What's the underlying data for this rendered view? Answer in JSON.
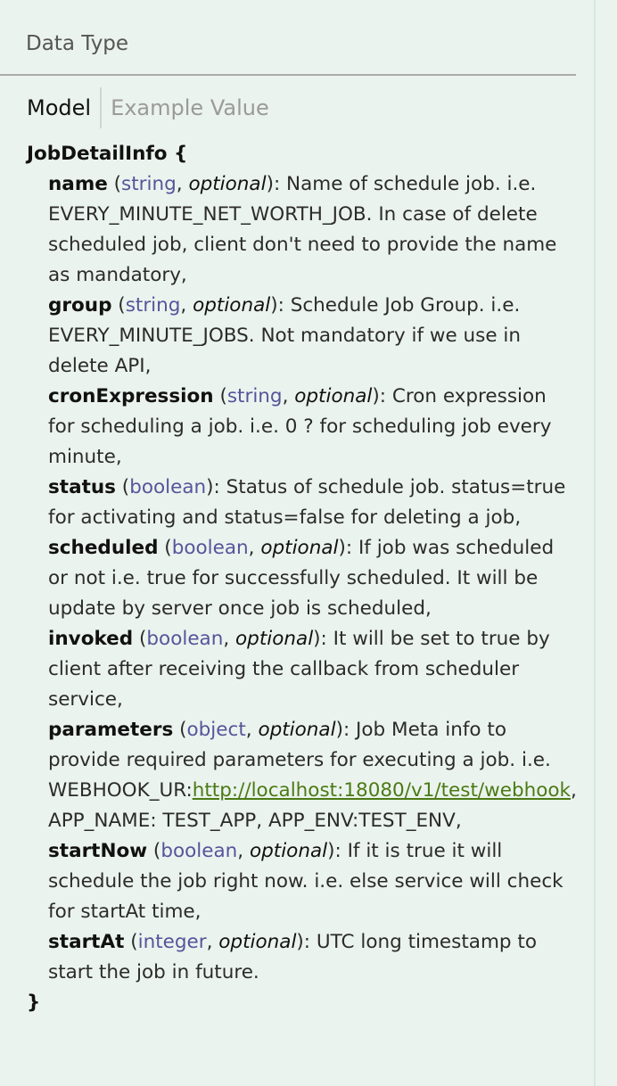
{
  "header": {
    "title": "Data Type"
  },
  "tabs": {
    "model_label": "Model",
    "example_label": "Example Value"
  },
  "model": {
    "title": "JobDetailInfo {",
    "closing": "}",
    "optional_word": "optional",
    "props": [
      {
        "name": "name",
        "type": "string",
        "optional": true,
        "desc": "Name of schedule job. i.e. EVERY_MINUTE_NET_WORTH_JOB. In case of delete scheduled job, client don't need to provide the name as mandatory,"
      },
      {
        "name": "group",
        "type": "string",
        "optional": true,
        "desc": "Schedule Job Group. i.e. EVERY_MINUTE_JOBS. Not mandatory if we use in delete API,"
      },
      {
        "name": "cronExpression",
        "type": "string",
        "optional": true,
        "desc": "Cron expression for scheduling a job. i.e. 0 ? for scheduling job every minute,"
      },
      {
        "name": "status",
        "type": "boolean",
        "optional": false,
        "desc": "Status of schedule job. status=true for activating and status=false for deleting a job,"
      },
      {
        "name": "scheduled",
        "type": "boolean",
        "optional": true,
        "desc": "If job was scheduled or not i.e. true for successfully scheduled. It will be update by server once job is scheduled,"
      },
      {
        "name": "invoked",
        "type": "boolean",
        "optional": true,
        "desc": "It will be set to true by client after receiving the callback from scheduler service,"
      },
      {
        "name": "parameters",
        "type": "object",
        "optional": true,
        "desc": "Job Meta info to provide required parameters for executing a job. i.e. WEBHOOK_UR:",
        "link": "http://localhost:18080/v1/test/webhook",
        "desc_after": ", APP_NAME: TEST_APP, APP_ENV:TEST_ENV,"
      },
      {
        "name": "startNow",
        "type": "boolean",
        "optional": true,
        "desc": "If it is true it will schedule the job right now. i.e. else service will check for startAt time,"
      },
      {
        "name": "startAt",
        "type": "integer",
        "optional": true,
        "desc": "UTC long timestamp to start the job in future."
      }
    ]
  }
}
